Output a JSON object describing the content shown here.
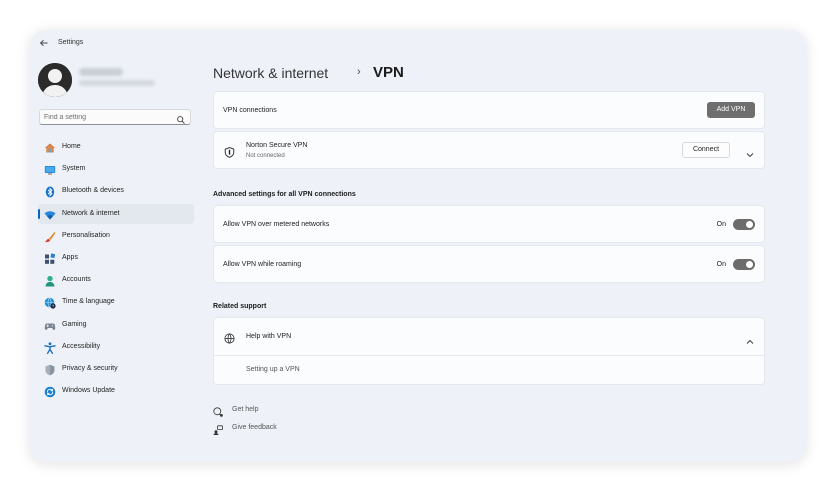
{
  "window": {
    "title": "Settings"
  },
  "search": {
    "placeholder": "Find a setting"
  },
  "sidebar": {
    "items": [
      {
        "label": "Home",
        "icon": "home-icon"
      },
      {
        "label": "System",
        "icon": "monitor-icon"
      },
      {
        "label": "Bluetooth & devices",
        "icon": "bluetooth-icon"
      },
      {
        "label": "Network & internet",
        "icon": "wifi-icon",
        "active": true
      },
      {
        "label": "Personalisation",
        "icon": "brush-icon"
      },
      {
        "label": "Apps",
        "icon": "apps-icon"
      },
      {
        "label": "Accounts",
        "icon": "person-icon"
      },
      {
        "label": "Time & language",
        "icon": "globe-clock-icon"
      },
      {
        "label": "Gaming",
        "icon": "gamepad-icon"
      },
      {
        "label": "Accessibility",
        "icon": "accessibility-icon"
      },
      {
        "label": "Privacy & security",
        "icon": "shield-icon"
      },
      {
        "label": "Windows Update",
        "icon": "update-icon"
      }
    ]
  },
  "header": {
    "parent": "Network & internet",
    "separator": "›",
    "current": "VPN"
  },
  "vpn_connections": {
    "label": "VPN connections",
    "add_button": "Add VPN"
  },
  "vpn_entry": {
    "name": "Norton Secure VPN",
    "status": "Not connected",
    "connect_button": "Connect"
  },
  "advanced": {
    "title": "Advanced settings for all VPN connections",
    "settings": [
      {
        "label": "Allow VPN over metered networks",
        "state": "On"
      },
      {
        "label": "Allow VPN while roaming",
        "state": "On"
      }
    ]
  },
  "related": {
    "title": "Related support",
    "help_title": "Help with VPN",
    "help_link": "Setting up a VPN"
  },
  "footer": {
    "get_help": "Get help",
    "give_feedback": "Give feedback"
  },
  "colors": {
    "accent": "#0067c0",
    "window_bg": "#eef2f8",
    "card_bg": "#fbfcfd",
    "toggle_on": "#6c6c6c"
  }
}
